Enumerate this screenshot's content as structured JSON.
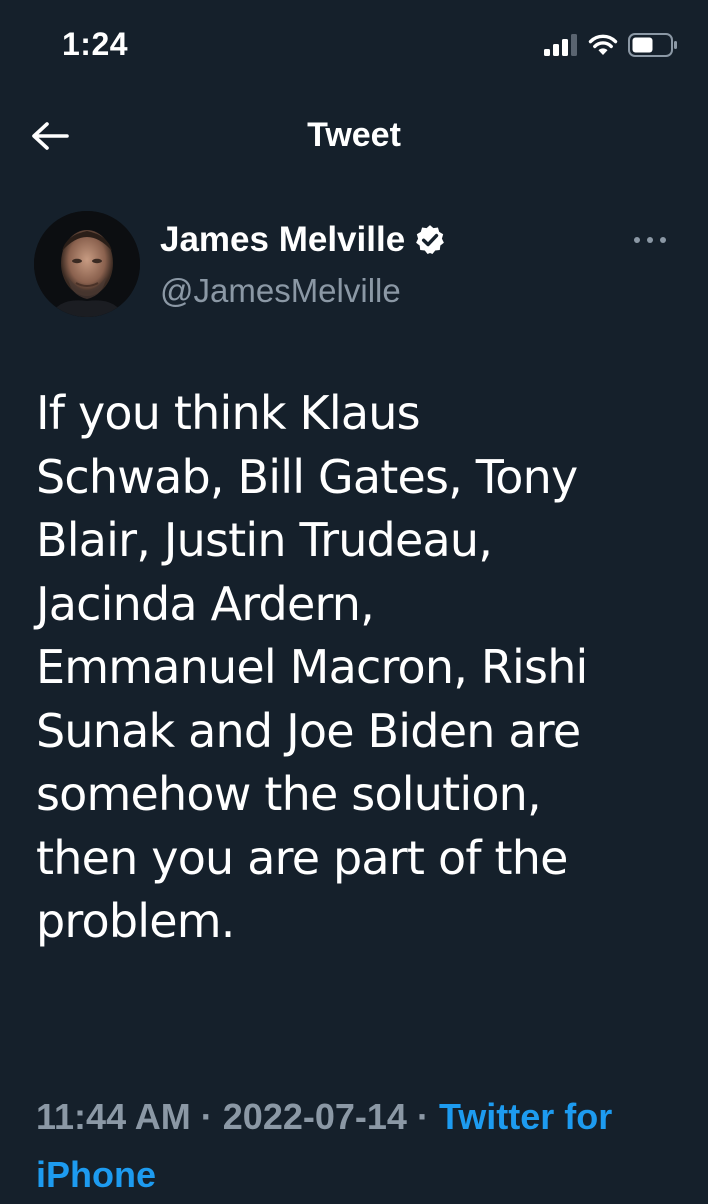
{
  "status_bar": {
    "time": "1:24",
    "icons": [
      "cellular-signal-icon",
      "wifi-icon",
      "battery-icon"
    ]
  },
  "nav": {
    "back_icon": "arrow-left-icon",
    "title": "Tweet"
  },
  "tweet": {
    "author": {
      "display_name": "James Melville",
      "username": "@JamesMelville",
      "verified": true,
      "verified_icon": "verified-badge-icon"
    },
    "more_icon": "more-dots-icon",
    "text": "If you think Klaus\nSchwab, Bill Gates, Tony\nBlair, Justin Trudeau,\nJacinda Ardern,\nEmmanuel Macron, Rishi\nSunak and Joe Biden are\nsomehow the solution,\nthen you are part of the\nproblem.",
    "time": "11:44 AM",
    "separator": "·",
    "date": "2022-07-14",
    "source": "Twitter for iPhone"
  },
  "colors": {
    "background": "#15202b",
    "text_primary": "#ffffff",
    "text_secondary": "#8b98a5",
    "accent": "#1d9bf0"
  }
}
